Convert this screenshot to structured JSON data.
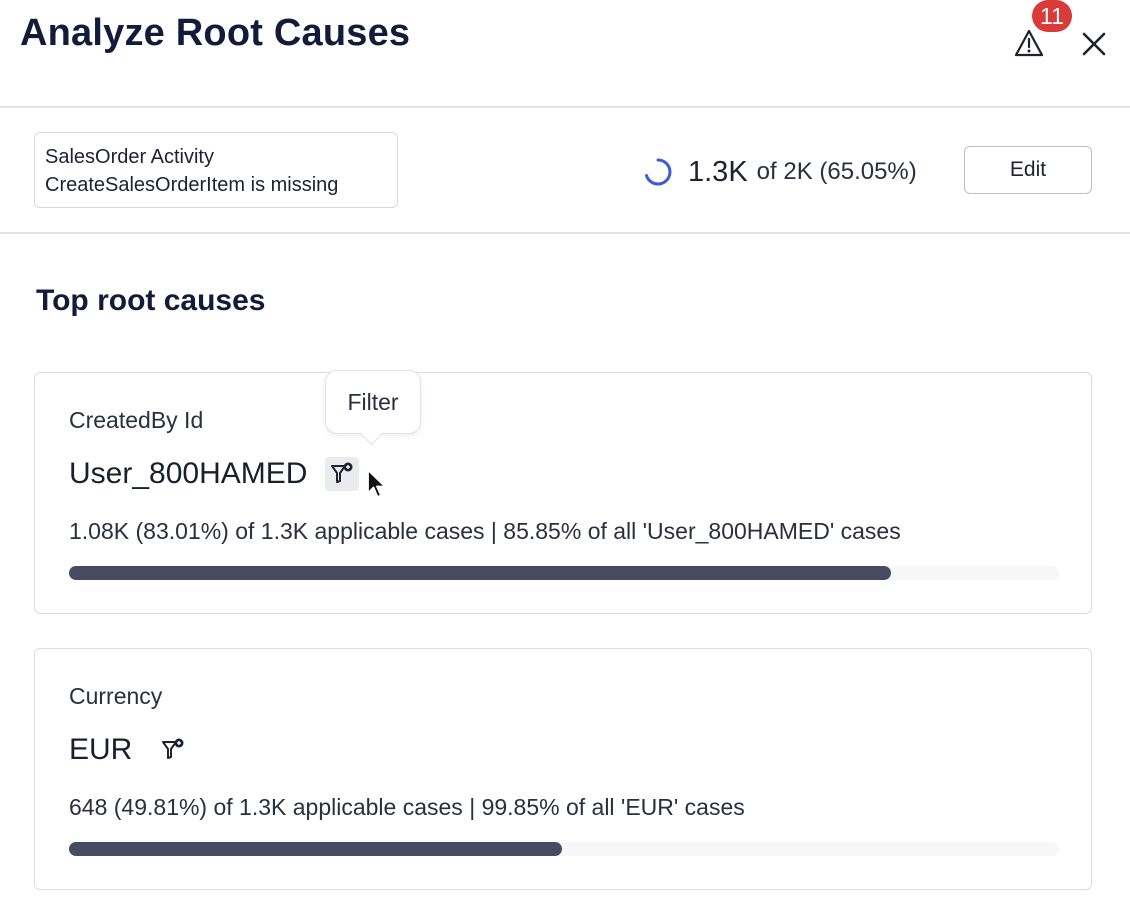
{
  "header": {
    "title": "Analyze Root Causes",
    "alerts_badge": "11",
    "alerts_icon": "warning-triangle-icon",
    "close_icon": "close-icon"
  },
  "criteria": {
    "line1": "SalesOrder Activity",
    "line2": "CreateSalesOrderItem is missing"
  },
  "summary": {
    "count": "1.3K",
    "of_total": "of 2K (65.05%)",
    "edit_label": "Edit",
    "spinner_color": "#3b5bdb"
  },
  "root_causes": {
    "section_title": "Top root causes",
    "tooltip": "Filter",
    "items": [
      {
        "label": "CreatedBy Id",
        "value": "User_800HAMED",
        "stats": "1.08K (83.01%) of 1.3K applicable cases | 85.85% of all 'User_800HAMED' cases",
        "share_percent": 83.01
      },
      {
        "label": "Currency",
        "value": "EUR",
        "stats": "648 (49.81%) of 1.3K applicable cases | 99.85% of all 'EUR' cases",
        "share_percent": 49.81
      }
    ]
  },
  "colors": {
    "bar_fill": "#474c63",
    "badge": "#d93a3a",
    "text": "#131b3a"
  }
}
